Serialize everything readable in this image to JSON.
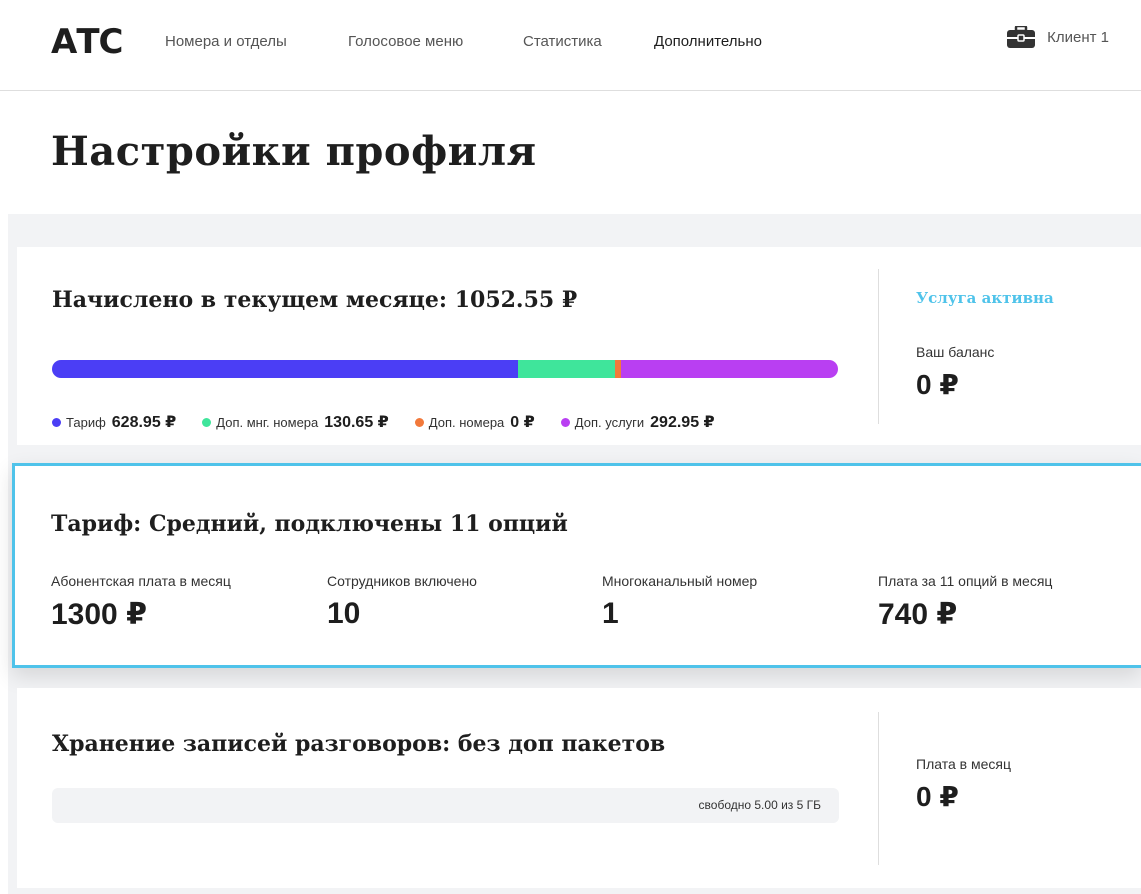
{
  "header": {
    "logo": "АТС",
    "nav": [
      "Номера и отделы",
      "Голосовое меню",
      "Статистика",
      "Дополнительно"
    ],
    "active_nav": "Дополнительно",
    "client_label": "Клиент 1",
    "client_icon": "briefcase-icon"
  },
  "page_title": "Настройки профиля",
  "billing": {
    "title": "Начислено в текущем месяце: 1052.55 ₽",
    "status": "Услуга активна",
    "balance_label": "Ваш баланс",
    "balance_value": "0 ₽",
    "legend": [
      {
        "label": "Тариф",
        "value": "628.95 ₽",
        "color": "#4b3ef5",
        "amount": 628.95
      },
      {
        "label": "Доп. мнг. номера",
        "value": "130.65 ₽",
        "color": "#3fe59b",
        "amount": 130.65
      },
      {
        "label": "Доп. номера",
        "value": "0 ₽",
        "color": "#f2793b",
        "amount": 0
      },
      {
        "label": "Доп. услуги",
        "value": "292.95 ₽",
        "color": "#b93ff2",
        "amount": 292.95
      }
    ]
  },
  "tariff": {
    "title": "Тариф: Средний, подключены 11 опций",
    "stats": [
      {
        "label": "Абонентская плата в месяц",
        "value": "1300 ₽"
      },
      {
        "label": "Сотрудников включено",
        "value": "10"
      },
      {
        "label": "Многоканальный номер",
        "value": "1"
      },
      {
        "label": "Плата за 11 опций в месяц",
        "value": "740 ₽"
      }
    ]
  },
  "storage": {
    "title": "Хранение записей разговоров: без доп пакетов",
    "usage_text": "свободно 5.00 из 5 ГБ",
    "used_fraction": 0,
    "fee_label": "Плата в месяц",
    "fee_value": "0 ₽"
  }
}
